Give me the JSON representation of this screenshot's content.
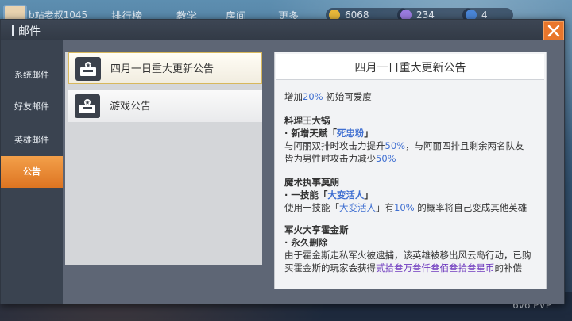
{
  "topbar": {
    "player": "b站老叔1045",
    "leaderboard": "排行榜",
    "teaching": "教学",
    "room": "房间",
    "more": "更多",
    "gold": "6068",
    "gems": "234",
    "level": "4"
  },
  "colors": {
    "accent": "#e8762c",
    "highlight_blue": "#3f6fd1",
    "highlight_purple": "#6f3bbf"
  },
  "dialog": {
    "title": "邮件",
    "close_icon": "close-icon",
    "tabs": [
      {
        "label": "系统邮件",
        "active": false
      },
      {
        "label": "好友邮件",
        "active": false
      },
      {
        "label": "英雄邮件",
        "active": false
      },
      {
        "label": "公告",
        "active": true
      }
    ],
    "list": [
      {
        "label": "四月一日重大更新公告",
        "icon": "mailbox-icon",
        "selected": true
      },
      {
        "label": "游戏公告",
        "icon": "mailbox-icon",
        "selected": false
      }
    ],
    "detail": {
      "title": "四月一日重大更新公告",
      "intro": {
        "a": "增加",
        "b": "20%",
        "c": " 初始可爱度"
      },
      "s1": {
        "heading": "料理王大锅",
        "bullet_a": "·  新增天赋「",
        "bullet_b": "死忠粉",
        "bullet_c": "」",
        "line1_a": "与阿丽双排时攻击力提升",
        "line1_b": "50%",
        "line1_c": "，与阿丽四排且剩余两名队友",
        "line2_a": "皆为男性时攻击力减少",
        "line2_b": "50%"
      },
      "s2": {
        "heading": "魔术执事莫朗",
        "bullet_a": "·  一技能「",
        "bullet_b": "大变活人",
        "bullet_c": "」",
        "line1_a": "使用一技能「",
        "line1_b": "大变活人",
        "line1_c": "」有",
        "line1_d": "10%",
        "line1_e": " 的概率将自己变成其他英雄"
      },
      "s3": {
        "heading": "军火大亨霍金斯",
        "bullet": "·  永久删除",
        "line1": "由于霍金斯走私军火被逮捕，该英雄被移出风云岛行动，已购",
        "line2_a": "买霍金斯的玩家会获得",
        "line2_b": "贰拾叁万叁仟叁佰叁拾叁星币",
        "line2_c": "的补偿"
      }
    }
  },
  "bottom": {
    "pvp": "6v6 PVP"
  }
}
